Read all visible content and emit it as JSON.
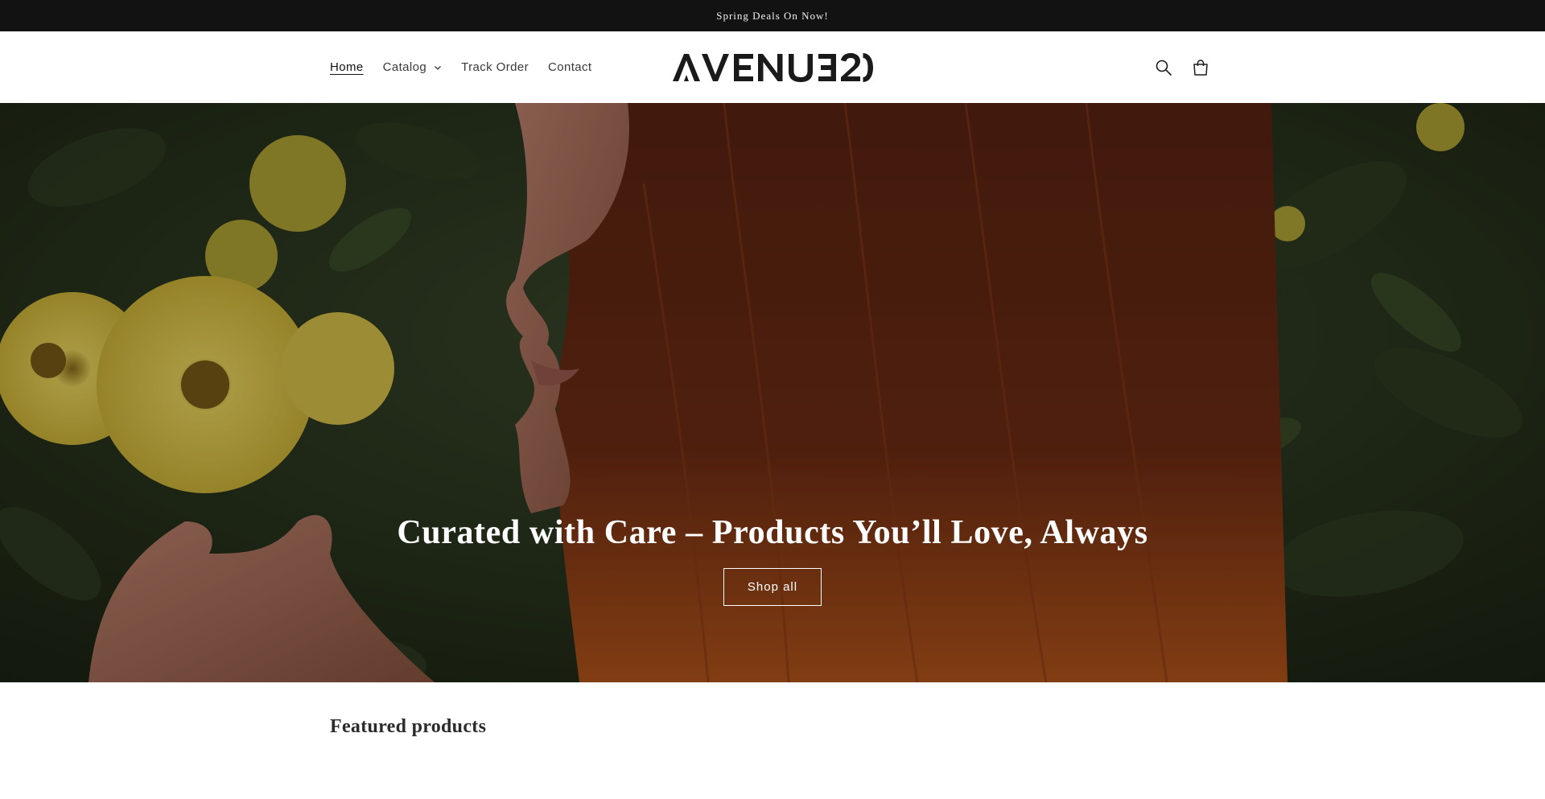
{
  "announcement": {
    "text": "Spring Deals On Now!"
  },
  "header": {
    "nav": [
      {
        "label": "Home",
        "active": true
      },
      {
        "label": "Catalog",
        "has_dropdown": true
      },
      {
        "label": "Track Order"
      },
      {
        "label": "Contact"
      }
    ],
    "logo_text": "AVENUE20",
    "icons": [
      "search-icon",
      "cart-icon"
    ]
  },
  "hero": {
    "heading": "Curated with Care – Products You’ll Love, Always",
    "button_label": "Shop all"
  },
  "featured": {
    "title": "Featured products"
  },
  "colors": {
    "announcement_bg": "#121212",
    "text_dark": "#121212",
    "hero_foliage": "#2a3320",
    "hero_hair": "#8a3a1a",
    "flowers": "#e8d24a"
  }
}
